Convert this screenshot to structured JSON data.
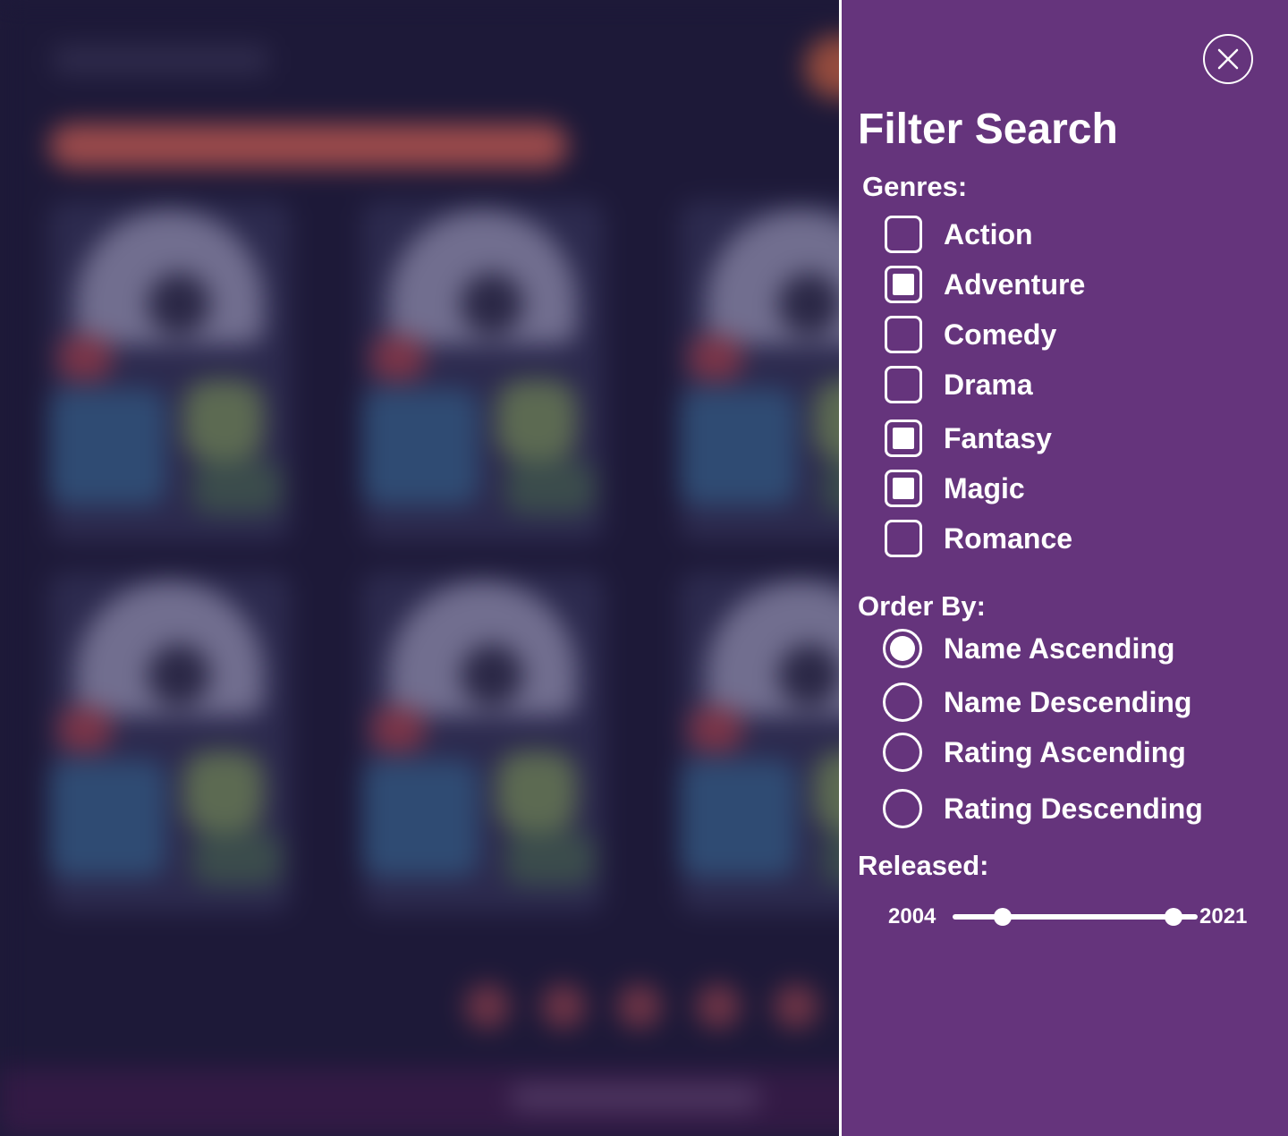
{
  "panel": {
    "title": "Filter Search",
    "genres_label": "Genres:",
    "genres": [
      {
        "label": "Action",
        "checked": false
      },
      {
        "label": "Adventure",
        "checked": true
      },
      {
        "label": "Comedy",
        "checked": false
      },
      {
        "label": "Drama",
        "checked": false
      },
      {
        "label": "Fantasy",
        "checked": true
      },
      {
        "label": "Magic",
        "checked": true
      },
      {
        "label": "Romance",
        "checked": false
      }
    ],
    "order_label": "Order By:",
    "order_options": [
      {
        "label": "Name Ascending",
        "selected": true
      },
      {
        "label": "Name Descending",
        "selected": false
      },
      {
        "label": "Rating Ascending",
        "selected": false
      },
      {
        "label": "Rating Descending",
        "selected": false
      }
    ],
    "released_label": "Released:",
    "released": {
      "min": "2004",
      "max": "2021"
    },
    "close_icon": "close-icon"
  },
  "colors": {
    "panel_bg": "#65347c",
    "page_bg": "#1d1938",
    "text": "#ffffff"
  }
}
